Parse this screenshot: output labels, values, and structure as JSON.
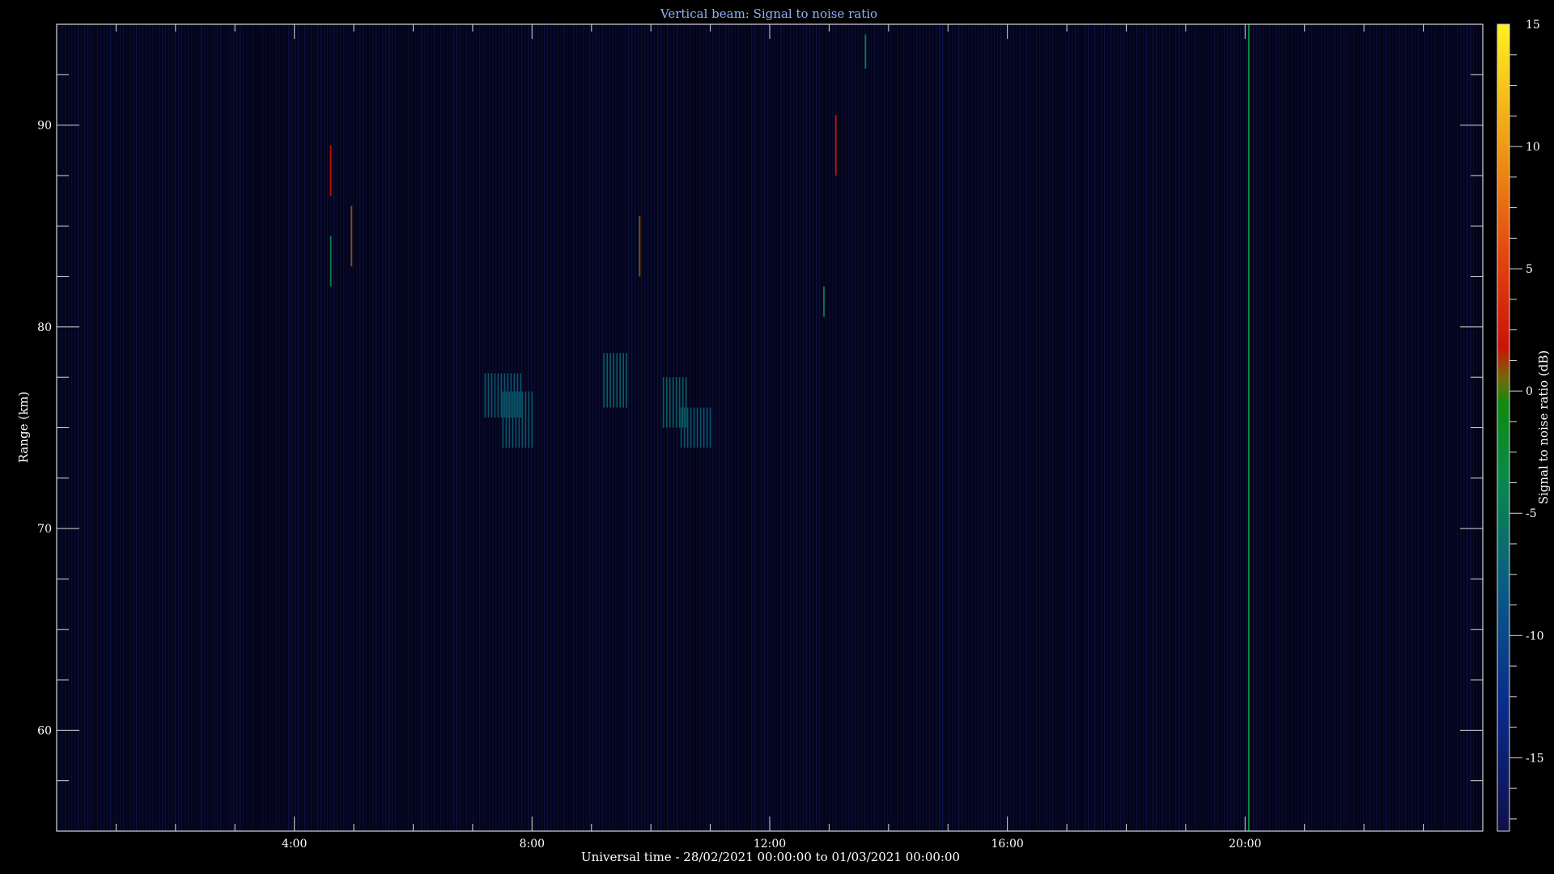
{
  "chart_data": {
    "type": "heatmap",
    "title": "Vertical beam: Signal to noise ratio",
    "xlabel": "Universal time - 28/02/2021 00:00:00 to 01/03/2021 00:00:00",
    "ylabel": "Range (km)",
    "colorbar_label": "Signal to noise ratio (dB)",
    "xlim": [
      0,
      24
    ],
    "ylim": [
      55,
      95
    ],
    "clim": [
      -18,
      15
    ],
    "x_ticks": [
      {
        "value": 4,
        "label": "4:00"
      },
      {
        "value": 8,
        "label": "8:00"
      },
      {
        "value": 12,
        "label": "12:00"
      },
      {
        "value": 16,
        "label": "16:00"
      },
      {
        "value": 20,
        "label": "20:00"
      }
    ],
    "y_ticks": [
      {
        "value": 60,
        "label": "60"
      },
      {
        "value": 70,
        "label": "70"
      },
      {
        "value": 80,
        "label": "80"
      },
      {
        "value": 90,
        "label": "90"
      }
    ],
    "colorbar_ticks": [
      {
        "value": -15,
        "label": "-15"
      },
      {
        "value": -10,
        "label": "-10"
      },
      {
        "value": -5,
        "label": "-5"
      },
      {
        "value": 0,
        "label": "0"
      },
      {
        "value": 5,
        "label": "5"
      },
      {
        "value": 10,
        "label": "10"
      },
      {
        "value": 15,
        "label": "15"
      }
    ],
    "background_snr_db": -17,
    "features": [
      {
        "t_start": 7.2,
        "t_end": 7.8,
        "range_low": 75.5,
        "range_high": 77.7,
        "snr_db": -7
      },
      {
        "t_start": 7.5,
        "t_end": 8.0,
        "range_low": 74.0,
        "range_high": 76.8,
        "snr_db": -7
      },
      {
        "t_start": 9.2,
        "t_end": 9.6,
        "range_low": 76.0,
        "range_high": 78.7,
        "snr_db": -6
      },
      {
        "t_start": 10.2,
        "t_end": 10.6,
        "range_low": 75.0,
        "range_high": 77.5,
        "snr_db": -6
      },
      {
        "t_start": 10.5,
        "t_end": 11.0,
        "range_low": 74.0,
        "range_high": 76.0,
        "snr_db": -7
      },
      {
        "t_start": 4.6,
        "t_end": 4.63,
        "range_low": 86.5,
        "range_high": 89.0,
        "snr_db": 2
      },
      {
        "t_start": 4.6,
        "t_end": 4.63,
        "range_low": 82.0,
        "range_high": 84.5,
        "snr_db": -4
      },
      {
        "t_start": 4.95,
        "t_end": 4.98,
        "range_low": 83.0,
        "range_high": 86.0,
        "snr_db": 1
      },
      {
        "t_start": 9.8,
        "t_end": 9.83,
        "range_low": 82.5,
        "range_high": 85.5,
        "snr_db": 1
      },
      {
        "t_start": 13.1,
        "t_end": 13.13,
        "range_low": 87.5,
        "range_high": 90.5,
        "snr_db": 2
      },
      {
        "t_start": 12.9,
        "t_end": 12.93,
        "range_low": 80.5,
        "range_high": 82.0,
        "snr_db": -5
      },
      {
        "t_start": 13.6,
        "t_end": 13.63,
        "range_low": 92.8,
        "range_high": 94.5,
        "snr_db": -5
      },
      {
        "t_start": 20.05,
        "t_end": 20.08,
        "range_low": 55,
        "range_high": 95,
        "snr_db": -3
      }
    ]
  }
}
